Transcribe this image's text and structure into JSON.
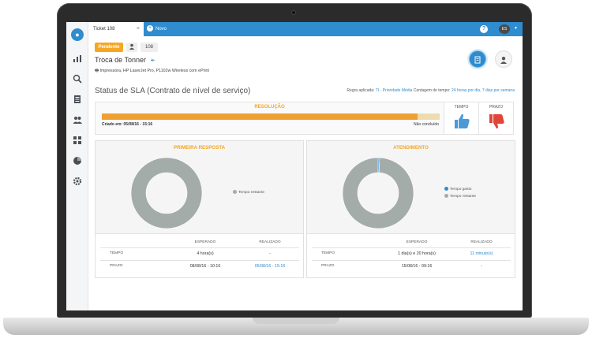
{
  "app": {
    "tab_active": "Ticket 108",
    "tab_close": "×",
    "tab_new": "Novo",
    "help": "?",
    "user_initials": "ES"
  },
  "ticket": {
    "status": "Pendente",
    "number": "108",
    "title": "Troca de Tonner",
    "equipment": "Impressora, HP LaserJet Pro, P1102w Wireless com ePrint"
  },
  "sla": {
    "title": "Status de SLA (Contrato de nível de serviço)",
    "rule_prefix": "Regra aplicada:",
    "rule_value": "TI - Prioridade Média",
    "time_prefix": "Contagem de tempo:",
    "time_value": "24 horas por dia, 7 dias por semana",
    "resolution": {
      "label": "RESOLUÇÃO",
      "created": "Criado em: 05/08/16 - 15:16",
      "status": "Não concluído",
      "progress": 0.935
    },
    "votes": {
      "tempo": "TEMPO",
      "prazo": "PRAZO"
    }
  },
  "cards": [
    {
      "title": "PRIMEIRA RESPOSTA",
      "legend": [
        {
          "label": "Tempo restante",
          "color": "#a4acaa"
        }
      ],
      "slices": [
        {
          "value": 1.0,
          "color": "#a4acaa"
        }
      ],
      "header": {
        "esperado": "ESPERADO",
        "realizado": "REALIZADO"
      },
      "rows": [
        {
          "label": "TEMPO",
          "esperado": "4 hora(s)",
          "realizado": "-"
        },
        {
          "label": "PRAZO",
          "esperado": "08/08/16 - 10:16",
          "realizado": "05/08/16 - 15:16"
        }
      ]
    },
    {
      "title": "ATENDIMENTO",
      "legend": [
        {
          "label": "Tempo gasto",
          "color": "#2e8ccf"
        },
        {
          "label": "Tempo restante",
          "color": "#a4acaa"
        }
      ],
      "slices": [
        {
          "value": 0.007,
          "color": "#2e8ccf"
        },
        {
          "value": 0.993,
          "color": "#a4acaa"
        }
      ],
      "header": {
        "esperado": "ESPERADO",
        "realizado": "REALIZADO"
      },
      "rows": [
        {
          "label": "TEMPO",
          "esperado": "1 dia(s) e 20 hora(s)",
          "realizado": "11 minuto(s)"
        },
        {
          "label": "PRAZO",
          "esperado": "15/08/16 - 09:16",
          "realizado": "-"
        }
      ]
    }
  ],
  "colors": {
    "brand_blue": "#2e8ccf",
    "orange": "#f5a623",
    "thumb_up": "#4a9ad8",
    "thumb_down": "#e0453a"
  },
  "icons": [
    "user-circle-icon",
    "chart-icon",
    "search-icon",
    "list-icon",
    "team-icon",
    "puzzle-icon",
    "pie-icon",
    "gear-icon",
    "document-icon",
    "user-icon",
    "thumbs-up-icon",
    "thumbs-down-icon",
    "pencil-icon",
    "printer-icon"
  ]
}
